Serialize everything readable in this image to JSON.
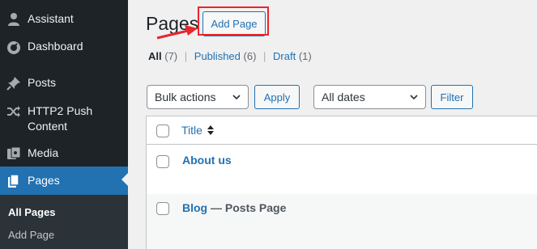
{
  "sidebar": {
    "items": [
      {
        "label": "Assistant",
        "icon": "person-icon"
      },
      {
        "label": "Dashboard",
        "icon": "dashboard-icon"
      },
      {
        "label": "Posts",
        "icon": "pushpin-icon"
      },
      {
        "label": "HTTP2 Push Content",
        "icon": "shuffle-icon"
      },
      {
        "label": "Media",
        "icon": "media-icon"
      },
      {
        "label": "Pages",
        "icon": "pages-icon"
      }
    ],
    "submenu": [
      {
        "label": "All Pages"
      },
      {
        "label": "Add Page"
      }
    ],
    "active_color": "#2271b1"
  },
  "header": {
    "title": "Pages",
    "add_button": "Add Page",
    "highlight_color": "#e8262b"
  },
  "views": {
    "all_label": "All",
    "all_count": "(7)",
    "published_label": "Published",
    "published_count": "(6)",
    "draft_label": "Draft",
    "draft_count": "(1)",
    "separator": "|"
  },
  "filters": {
    "bulk_actions": "Bulk actions",
    "apply": "Apply",
    "dates": "All dates",
    "filter": "Filter"
  },
  "table": {
    "column_title": "Title",
    "rows": [
      {
        "title": "About us",
        "state": ""
      },
      {
        "title": "Blog",
        "state": "— Posts Page"
      }
    ]
  }
}
